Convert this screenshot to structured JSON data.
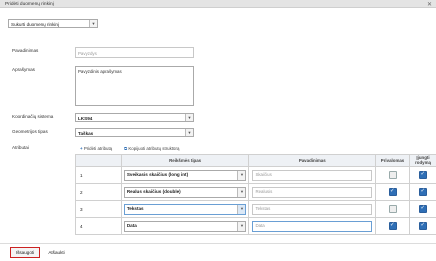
{
  "window": {
    "title": "Pridėti duomenų rinkinį",
    "close_glyph": "✕"
  },
  "create_dropdown": {
    "value": "Sukurti duomenų rinkinį"
  },
  "form": {
    "name_label": "Pavadinimas",
    "name_placeholder": "Pavyzdys",
    "description_label": "Aprašymas",
    "description_value": "Pavyzdinis aprašymas",
    "crs_label": "Koordinačių sistema",
    "crs_value": "LKS94",
    "geometry_label": "Geometrijos tipas",
    "geometry_value": "Taškas",
    "attributes_label": "Atributai"
  },
  "attr_toolbar": {
    "add_label": "Pridėti atributą",
    "copy_label": "Kopijuoti atributų struktūrą"
  },
  "table": {
    "headers": {
      "num": "",
      "type": "Reikšmės tipas",
      "name": "Pavadinimas",
      "required": "Privalomas",
      "show_line1": "Įjungti",
      "show_line2": "rodymą"
    },
    "rows": [
      {
        "num": "1",
        "type": "Sveikasis skaičius (long int)",
        "name_ph": "Skaičius",
        "required": false,
        "show": true
      },
      {
        "num": "2",
        "type": "Realus skaičius (double)",
        "name_ph": "Realusis",
        "required": true,
        "show": true
      },
      {
        "num": "3",
        "type": "Tekstas",
        "name_ph": "Tekstas",
        "required": false,
        "show": true
      },
      {
        "num": "4",
        "type": "Data",
        "name_ph": "Data",
        "required": true,
        "show": true
      }
    ]
  },
  "footer": {
    "save_label": "Išsaugoti",
    "cancel_label": "Atšaukti"
  },
  "colors": {
    "accent": "#2f6fb6",
    "save_border": "#cc2222"
  }
}
